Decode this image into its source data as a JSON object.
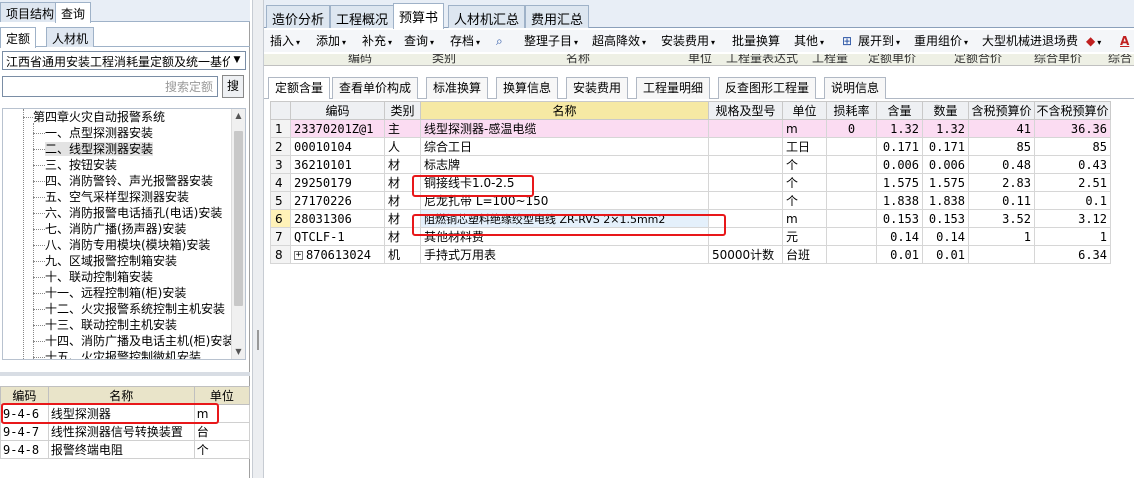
{
  "left_pane": {
    "top_tabs": [
      "项目结构",
      "查询"
    ],
    "sub_tabs": [
      "定额",
      "人材机"
    ],
    "library_select": "江西省通用安装工程消耗量定额及统一基价",
    "search": {
      "placeholder": "搜索定额",
      "button": "搜"
    },
    "tree": {
      "parent": "第四章火灾自动报警系统",
      "items": [
        "一、点型探测器安装",
        "二、线型探测器安装",
        "三、按钮安装",
        "四、消防警铃、声光报警器安装",
        "五、空气采样型探测器安装",
        "六、消防报警电话插孔(电话)安装",
        "七、消防广播(扬声器)安装",
        "八、消防专用模块(模块箱)安装",
        "九、区域报警控制箱安装",
        "十、联动控制箱安装",
        "十一、远程控制箱(柜)安装",
        "十二、火灾报警系统控制主机安装",
        "十三、联动控制主机安装",
        "十四、消防广播及电话主机(柜)安装",
        "十五、火灾报警控制微机安装"
      ],
      "selected_index": 1
    },
    "quota_table": {
      "headers": [
        "编码",
        "名称",
        "单位"
      ],
      "rows": [
        {
          "code": "9-4-6",
          "name": "线型探测器",
          "unit": "m"
        },
        {
          "code": "9-4-7",
          "name": "线性探测器信号转换装置",
          "unit": "台"
        },
        {
          "code": "9-4-8",
          "name": "报警终端电阻",
          "unit": "个"
        }
      ]
    }
  },
  "right_pane": {
    "main_tabs": [
      "造价分析",
      "工程概况",
      "预算书",
      "人材机汇总",
      "费用汇总"
    ],
    "active_main_tab": "预算书",
    "toolbar": [
      "插入",
      "添加",
      "补充",
      "查询",
      "存档",
      "整理子目",
      "超高降效",
      "安装费用",
      "批量换算",
      "其他",
      "展开到",
      "重用组价",
      "大型机械进退场费"
    ],
    "hidden_header": [
      "编码",
      "类别",
      "名称",
      "单位",
      "工程量表达式",
      "工程量",
      "定额单价",
      "定额合价",
      "综合单价",
      "综合"
    ],
    "sub_tabs": [
      "定额含量",
      "查看单价构成",
      "标准换算",
      "换算信息",
      "安装费用",
      "工程量明细",
      "反查图形工程量",
      "说明信息"
    ],
    "grid": {
      "headers": [
        "",
        "编码",
        "类别",
        "名称",
        "规格及型号",
        "单位",
        "损耗率",
        "含量",
        "数量",
        "含税预算价",
        "不含税预算价"
      ],
      "rows": [
        {
          "no": "1",
          "code": "23370201Z@1",
          "type": "主",
          "name": "线型探测器-感温电缆",
          "spec": "",
          "unit": "m",
          "loss": "0",
          "content": "1.32",
          "qty": "1.32",
          "tax_price": "41",
          "notax_price": "36.36"
        },
        {
          "no": "2",
          "code": "00010104",
          "type": "人",
          "name": "综合工日",
          "spec": "",
          "unit": "工日",
          "loss": "",
          "content": "0.171",
          "qty": "0.171",
          "tax_price": "85",
          "notax_price": "85"
        },
        {
          "no": "3",
          "code": "36210101",
          "type": "材",
          "name": "标志牌",
          "spec": "",
          "unit": "个",
          "loss": "",
          "content": "0.006",
          "qty": "0.006",
          "tax_price": "0.48",
          "notax_price": "0.43"
        },
        {
          "no": "4",
          "code": "29250179",
          "type": "材",
          "name": "铜接线卡1.0-2.5",
          "spec": "",
          "unit": "个",
          "loss": "",
          "content": "1.575",
          "qty": "1.575",
          "tax_price": "2.83",
          "notax_price": "2.51"
        },
        {
          "no": "5",
          "code": "27170226",
          "type": "材",
          "name": "尼龙扎带 L=100~150",
          "spec": "",
          "unit": "个",
          "loss": "",
          "content": "1.838",
          "qty": "1.838",
          "tax_price": "0.11",
          "notax_price": "0.1"
        },
        {
          "no": "6",
          "code": "28031306",
          "type": "材",
          "name": "阻燃铜芯塑料绝缘绞型电线 ZR-RVS 2×1.5mm2",
          "spec": "",
          "unit": "m",
          "loss": "",
          "content": "0.153",
          "qty": "0.153",
          "tax_price": "3.52",
          "notax_price": "3.12"
        },
        {
          "no": "7",
          "code": "QTCLF-1",
          "type": "材",
          "name": "其他材料费",
          "spec": "",
          "unit": "元",
          "loss": "",
          "content": "0.14",
          "qty": "0.14",
          "tax_price": "1",
          "notax_price": "1"
        },
        {
          "no": "8",
          "code": "870613024",
          "type": "机",
          "name": "手持式万用表",
          "spec": "50000计数",
          "unit": "台班",
          "loss": "",
          "content": "0.01",
          "qty": "0.01",
          "tax_price": "",
          "notax_price": "6.34"
        }
      ]
    }
  },
  "colors": {
    "highlight_box": "#e8181a",
    "main_row": "#fbdcf2",
    "name_header": "#f6e9a4"
  }
}
